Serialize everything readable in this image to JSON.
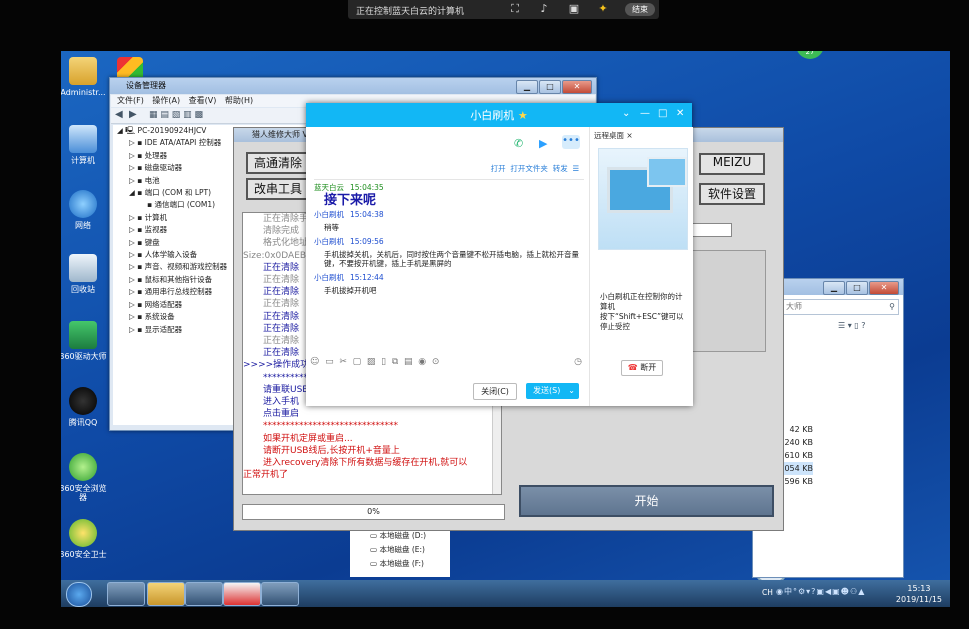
{
  "remote_bar": {
    "title": "正在控制蓝天白云的计算机",
    "end_label": "结束"
  },
  "desktop": {
    "icons": [
      {
        "label": "Administr..."
      },
      {
        "label": "计算机"
      },
      {
        "label": "网络"
      },
      {
        "label": "回收站"
      },
      {
        "label": "360驱动大师"
      },
      {
        "label": "腾讯QQ"
      },
      {
        "label": "360安全浏览器"
      },
      {
        "label": "360安全卫士"
      }
    ],
    "notify_badge": "27"
  },
  "device_manager": {
    "title": "设备管理器",
    "menu": [
      "文件(F)",
      "操作(A)",
      "查看(V)",
      "帮助(H)"
    ],
    "tree": [
      "PC-20190924HJCV",
      "IDE ATA/ATAPI 控制器",
      "处理器",
      "磁盘驱动器",
      "电池",
      "端口 (COM 和 LPT)",
      "通信端口 (COM1)",
      "计算机",
      "监视器",
      "键盘",
      "人体学输入设备",
      "声音、视频和游戏控制器",
      "鼠标和其他指针设备",
      "通用串行总线控制器",
      "网络适配器",
      "系统设备",
      "显示适配器"
    ]
  },
  "flash_tool": {
    "title": "猎人维修大师 V",
    "btn_clear": "高通清除",
    "btn_tools": "改串工具",
    "btn_meizu": "MEIZU",
    "btn_settings": "软件设置",
    "log": [
      {
        "text": "正在清除手",
        "color": "#888888"
      },
      {
        "text": "清除完成",
        "color": "#888888"
      },
      {
        "text": "格式化地址",
        "color": "#888888"
      },
      {
        "text": "Size:0x0DAEB",
        "color": "#888888"
      },
      {
        "text": "正在清除",
        "color": "#1a1aa0"
      },
      {
        "text": "正在清除",
        "color": "#888888"
      },
      {
        "text": "正在清除",
        "color": "#1a1aa0"
      },
      {
        "text": "正在清除",
        "color": "#888888"
      },
      {
        "text": "正在清除",
        "color": "#1a1aa0"
      },
      {
        "text": "正在清除",
        "color": "#1a1aa0"
      },
      {
        "text": "正在清除",
        "color": "#888888"
      },
      {
        "text": "正在清除",
        "color": "#1a1aa0"
      },
      {
        "text": ">>>>操作成功",
        "color": "#1a1aa0"
      },
      {
        "text": "**********",
        "color": "#1a1aa0"
      },
      {
        "text": "请重联USB",
        "color": "#1a1aa0"
      },
      {
        "text": "进入手机",
        "color": "#1a1aa0"
      },
      {
        "text": "点击重启",
        "color": "#1a1aa0"
      },
      {
        "text": "******************************",
        "color": "#d01010"
      },
      {
        "text": "如果开机定屏或重启...",
        "color": "#d01010"
      },
      {
        "text": "请断开USB线后,长按开机+音量上",
        "color": "#d01010"
      },
      {
        "text": "进入recovery清除下所有数据与缓存在开机,就可以",
        "color": "#d01010"
      },
      {
        "text": "正常开机了",
        "color": "#d01010"
      }
    ],
    "progress_label": "0%",
    "progress": 0,
    "start_label": "开始"
  },
  "explorer": {
    "search_placeholder": "大师",
    "sizes": [
      "42 KB",
      "240 KB",
      "610 KB",
      "054 KB",
      "596 KB"
    ],
    "drives": [
      "本地磁盘 (D:)",
      "本地磁盘 (E:)",
      "本地磁盘 (F:)"
    ]
  },
  "qq": {
    "title": "小白刷机",
    "file_actions": [
      "打开",
      "打开文件夹",
      "转发"
    ],
    "messages": [
      {
        "nick": "蓝天白云",
        "time": "15:04:35",
        "text": "接下来呢",
        "big": true,
        "mine": false
      },
      {
        "nick": "小白刷机",
        "time": "15:04:38",
        "text": "稍等",
        "big": false,
        "mine": true
      },
      {
        "nick": "小白刷机",
        "time": "15:09:56",
        "text": "手机拔掉关机，关机后，同时按住两个音量键不松开插电脑，插上就松开音量键，不要按开机键，插上手机是黑屏的",
        "big": false,
        "mine": true
      },
      {
        "nick": "小白刷机",
        "time": "15:12:44",
        "text": "手机拔掉开机吧",
        "big": false,
        "mine": true
      }
    ],
    "close_label": "关闭(C)",
    "send_label": "发送(S)",
    "side_tab": "远程桌面",
    "side_text1": "小白刷机正在控制你的计算机",
    "side_text2": "按下“Shift+ESC”键可以停止受控",
    "disconnect_label": "断开"
  },
  "taskbar": {
    "time": "15:13",
    "date": "2019/11/15",
    "ime": "CH"
  }
}
